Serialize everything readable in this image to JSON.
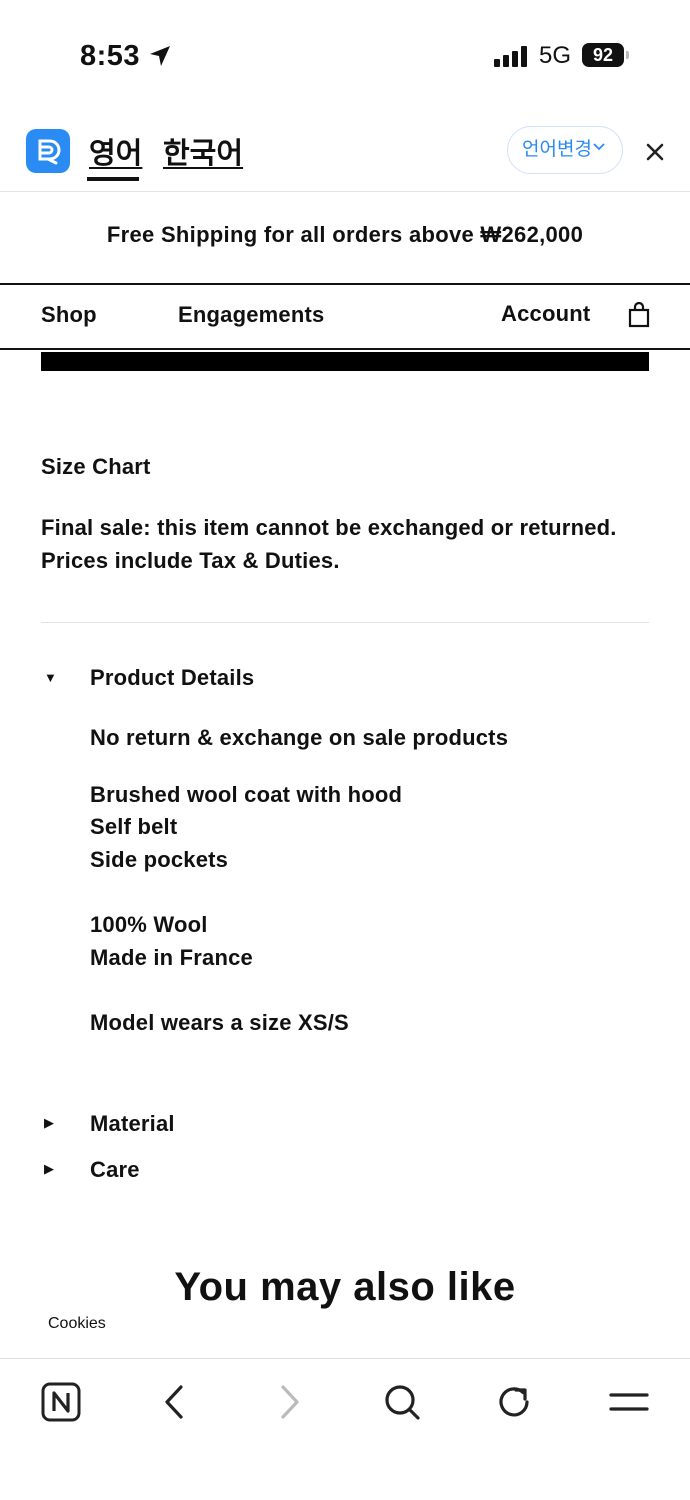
{
  "status_bar": {
    "time": "8:53",
    "network": "5G",
    "battery": "92"
  },
  "translate_bar": {
    "lang_source": "영어",
    "lang_target": "한국어",
    "change_language": "언어변경",
    "accent_color": "#2a8bf2"
  },
  "promo": {
    "text": "Free Shipping for all orders above ₩262,000"
  },
  "nav": {
    "shop": "Shop",
    "engagements": "Engagements",
    "account": "Account",
    "bag_icon": "shopping-bag-icon"
  },
  "product": {
    "size_chart": "Size Chart",
    "final_sale": "Final sale: this item cannot be exchanged or returned.",
    "prices_note": "Prices include Tax & Duties.",
    "details_heading": "Product Details",
    "details": {
      "no_return": "No return & exchange on sale products",
      "line1": "Brushed wool coat with hood",
      "line2": "Self belt",
      "line3": "Side pockets",
      "line4": "100% Wool",
      "line5": "Made in France",
      "line6": "Model wears a size XS/S"
    },
    "material_heading": "Material",
    "care_heading": "Care"
  },
  "recommendations": {
    "title": "You may also like"
  },
  "cookies": {
    "label": "Cookies"
  },
  "toolbar": {
    "icons": [
      "naver-home-icon",
      "back-icon",
      "forward-icon",
      "search-icon",
      "refresh-icon",
      "menu-icon"
    ]
  }
}
